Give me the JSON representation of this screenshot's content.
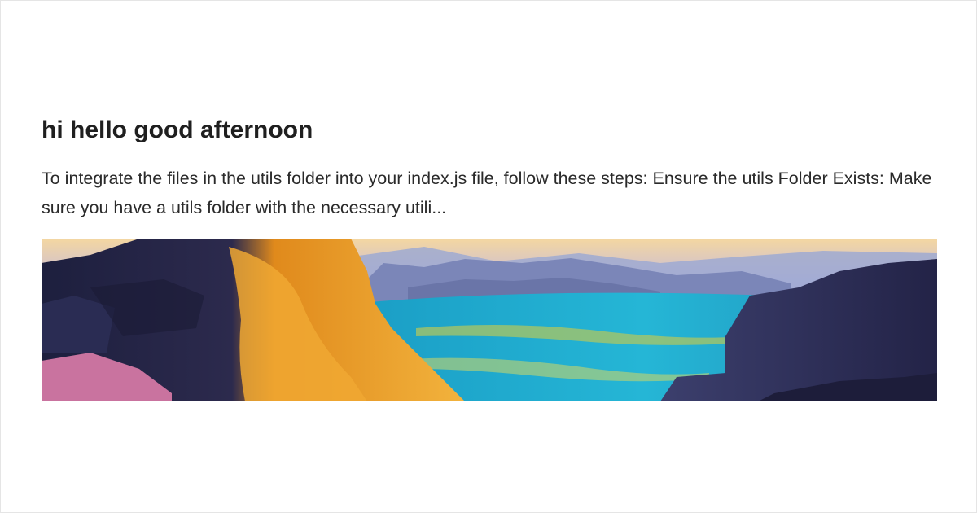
{
  "post": {
    "title": "hi hello good afternoon",
    "excerpt": "To integrate the files in the utils folder into your index.js file, follow these steps: Ensure the utils Folder Exists: Make sure you have a utils folder with the necessary utili..."
  },
  "banner": {
    "icon": "landscape-illustration"
  }
}
